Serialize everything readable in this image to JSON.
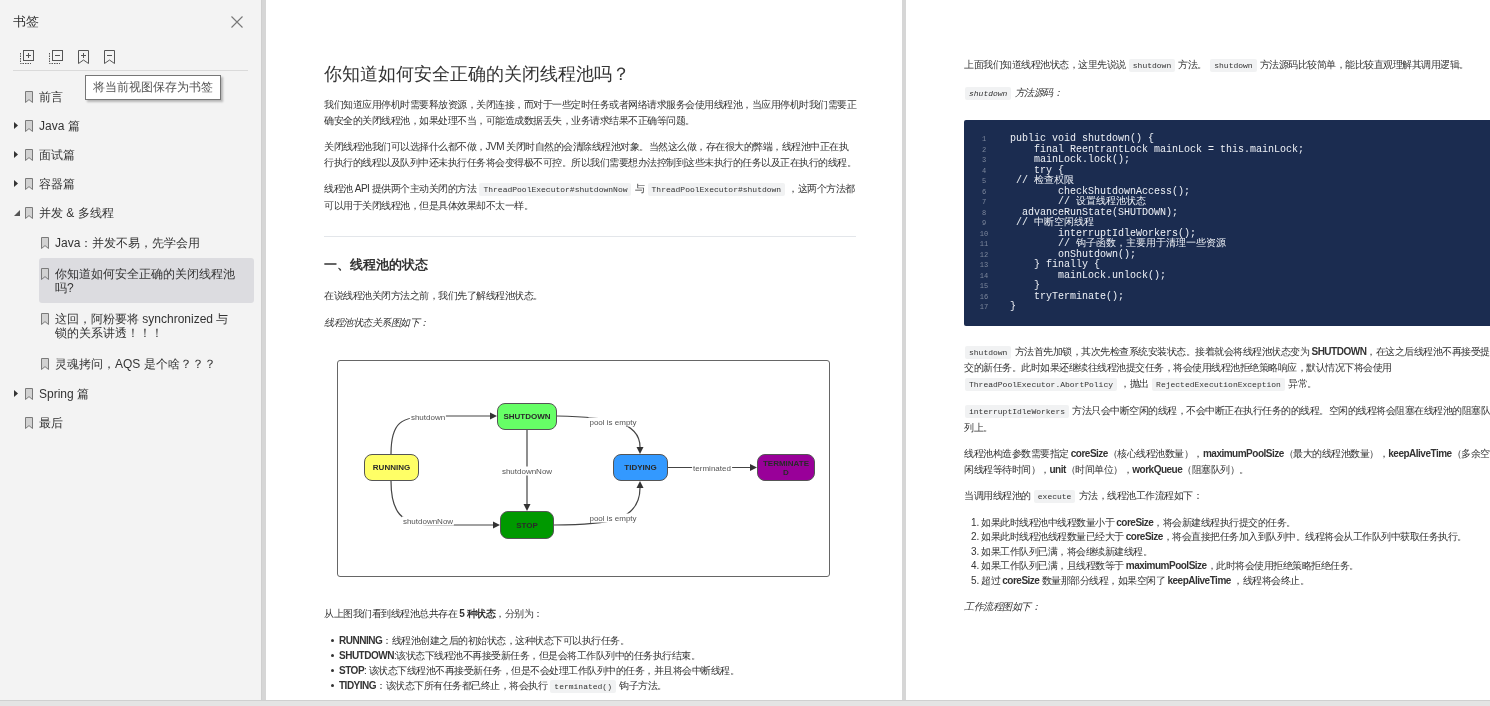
{
  "sidebar": {
    "title": "书签",
    "tooltip": "将当前视图保存为书签",
    "items": [
      {
        "label": "前言",
        "kind": "leaf",
        "selected": false
      },
      {
        "label": "Java 篇",
        "kind": "group",
        "expanded": false,
        "selected": false
      },
      {
        "label": "面试篇",
        "kind": "group",
        "expanded": false,
        "selected": false
      },
      {
        "label": "容器篇",
        "kind": "group",
        "expanded": false,
        "selected": false
      },
      {
        "label": "并发 & 多线程",
        "kind": "group",
        "expanded": true,
        "selected": false,
        "children": [
          {
            "label": "Java：并发不易，先学会用",
            "kind": "leaf",
            "selected": false
          },
          {
            "label": "你知道如何安全正确的关闭线程池吗?",
            "kind": "leaf",
            "selected": true
          },
          {
            "label": "这回，阿粉要将 synchronized 与锁的关系讲透！！！",
            "kind": "leaf",
            "selected": false
          },
          {
            "label": "灵魂拷问，AQS 是个啥？？？",
            "kind": "leaf",
            "selected": false
          }
        ]
      },
      {
        "label": "Spring 篇",
        "kind": "group",
        "expanded": false,
        "selected": false
      },
      {
        "label": "最后",
        "kind": "leaf",
        "selected": false
      }
    ]
  },
  "pages": [
    {
      "blocks": [
        {
          "kind": "title",
          "text": "你知道如何安全正确的关闭线程池吗？"
        },
        {
          "kind": "paragraph",
          "parts": [
            {
              "kind": "text",
              "text": "我们知道应用停机时需要释放资源，关闭连接，而对于一些定时任务或者网络请求服务会使用线程池，当应用停机时我们需要正确安全的关闭线程池，如果处理不当，可能造成数据丢失，业务请求结果不正确等问题。"
            }
          ]
        },
        {
          "kind": "paragraph",
          "parts": [
            {
              "kind": "text",
              "text": "关闭线程池我们可以选择什么都不做，JVM 关闭时自然的会清除线程池对象。当然这么做，存在很大的弊端，线程池中正在执行执行的线程以及队列中还未执行任务将会变得极不可控。所以我们需要想办法控制到这些未执行的任务以及正在执行的线程。"
            }
          ]
        },
        {
          "kind": "paragraph",
          "parts": [
            {
              "kind": "text",
              "text": "线程池 API 提供两个主动关闭的方法 "
            },
            {
              "kind": "code",
              "text": "ThreadPoolExecutor#shutdownNow"
            },
            {
              "kind": "text",
              "text": " 与 "
            },
            {
              "kind": "code",
              "text": "ThreadPoolExecutor#shutdown"
            },
            {
              "kind": "text",
              "text": " ，这两个方法都可以用于关闭线程池，但是具体效果却不太一样。"
            }
          ]
        },
        {
          "kind": "rule"
        },
        {
          "kind": "heading",
          "text": "一、线程池的状态"
        },
        {
          "kind": "paragraph",
          "parts": [
            {
              "kind": "text",
              "text": "在说线程池关闭方法之前，我们先了解线程池状态。"
            }
          ]
        },
        {
          "kind": "caption",
          "parts": [
            {
              "kind": "text",
              "text": "线程池状态关系图如下："
            }
          ]
        },
        {
          "kind": "diagram",
          "nodes": [
            {
              "label": "RUNNING",
              "color": "#ffff66"
            },
            {
              "label": "SHUTDOWN",
              "color": "#66ff66"
            },
            {
              "label": "STOP",
              "color": "#009900"
            },
            {
              "label": "TIDYING",
              "color": "#3399ff"
            },
            {
              "label": "TERMINATED",
              "color": "#990099"
            }
          ],
          "edges": [
            {
              "label": "shutdown"
            },
            {
              "label": "shutdownNow"
            },
            {
              "label": "shutdownNow"
            },
            {
              "label": "pool is empty"
            },
            {
              "label": "pool is empty"
            },
            {
              "label": "terminated"
            }
          ]
        },
        {
          "kind": "paragraph",
          "parts": [
            {
              "kind": "text",
              "text": "从上图我们看到线程池总共存在 **5 种状态**，分别为："
            }
          ]
        },
        {
          "kind": "bullets",
          "items": [
            {
              "parts": [
                {
                  "kind": "text",
                  "text": "**RUNNING**：线程池创建之后的初始状态，这种状态下可以执行任务。"
                }
              ]
            },
            {
              "parts": [
                {
                  "kind": "text",
                  "text": "**SHUTDOWN**:该状态下线程池不再接受新任务，但是会将工作队列中的任务执行结束。"
                }
              ]
            },
            {
              "parts": [
                {
                  "kind": "text",
                  "text": "**STOP**: 该状态下线程池不再接受新任务，但是不会处理工作队列中的任务，并且将会中断线程。"
                }
              ]
            },
            {
              "parts": [
                {
                  "kind": "text",
                  "text": "**TIDYING**：该状态下所有任务都已终止，将会执行 "
                },
                {
                  "kind": "code",
                  "text": "terminated()"
                },
                {
                  "kind": "text",
                  "text": " 钩子方法。"
                }
              ]
            }
          ]
        }
      ]
    },
    {
      "blocks": [
        {
          "kind": "paragraph",
          "parts": [
            {
              "kind": "text",
              "text": "上面我们知道线程池状态，这里先说说 "
            },
            {
              "kind": "code",
              "text": "shutdown"
            },
            {
              "kind": "text",
              "text": " 方法。 "
            },
            {
              "kind": "code",
              "text": "shutdown"
            },
            {
              "kind": "text",
              "text": " 方法源码比较简单，能比较直观理解其调用逻辑。"
            }
          ]
        },
        {
          "kind": "caption",
          "parts": [
            {
              "kind": "code",
              "text": "shutdown"
            },
            {
              "kind": "text",
              "text": " 方法源码："
            }
          ]
        },
        {
          "kind": "code",
          "lines": [
            {
              "number": "1",
              "text": "public void shutdown() {"
            },
            {
              "number": "2",
              "text": "    final ReentrantLock mainLock = this.mainLock;"
            },
            {
              "number": "3",
              "text": "    mainLock.lock();"
            },
            {
              "number": "4",
              "text": "    try {"
            },
            {
              "number": "5",
              "text": " // 检查权限"
            },
            {
              "number": "6",
              "text": "        checkShutdownAccess();"
            },
            {
              "number": "7",
              "text": "        // 设置线程池状态"
            },
            {
              "number": "8",
              "text": "  advanceRunState(SHUTDOWN);"
            },
            {
              "number": "9",
              "text": " // 中断空闲线程"
            },
            {
              "number": "10",
              "text": "        interruptIdleWorkers();"
            },
            {
              "number": "11",
              "text": "        // 钩子函数，主要用于清理一些资源"
            },
            {
              "number": "12",
              "text": "        onShutdown();"
            },
            {
              "number": "13",
              "text": "    } finally {"
            },
            {
              "number": "14",
              "text": "        mainLock.unlock();"
            },
            {
              "number": "15",
              "text": "    }"
            },
            {
              "number": "16",
              "text": "    tryTerminate();"
            },
            {
              "number": "17",
              "text": "}"
            }
          ]
        },
        {
          "kind": "paragraph",
          "parts": [
            {
              "kind": "code",
              "text": "shutdown"
            },
            {
              "kind": "text",
              "text": " 方法首先加锁，其次先检查系统安装状态。接着就会将线程池状态变为 **SHUTDOWN**，在这之后线程池不再接受提交的新任务。此时如果还继续往线程池提交任务，将会使用线程池拒绝策略响应，默认情况下将会使用 "
            },
            {
              "kind": "code",
              "text": "ThreadPoolExecutor.AbortPolicy"
            },
            {
              "kind": "text",
              "text": " ，抛出 "
            },
            {
              "kind": "code",
              "text": "RejectedExecutionException"
            },
            {
              "kind": "text",
              "text": " 异常。"
            }
          ]
        },
        {
          "kind": "paragraph",
          "parts": [
            {
              "kind": "code",
              "text": "interruptIdleWorkers"
            },
            {
              "kind": "text",
              "text": " 方法只会中断空闲的线程，不会中断正在执行任务的的线程。空闲的线程将会阻塞在线程池的阻塞队列上。"
            }
          ]
        },
        {
          "kind": "paragraph",
          "parts": [
            {
              "kind": "text",
              "text": "线程池构造参数需要指定 **coreSize**（核心线程池数量），**maximumPoolSize**（最大的线程池数量），**keepAliveTime**（多余空闲线程等待时间），**unit**（时间单位），**workQueue**（阻塞队列）。"
            }
          ]
        },
        {
          "kind": "paragraph",
          "parts": [
            {
              "kind": "text",
              "text": "当调用线程池的 "
            },
            {
              "kind": "code",
              "text": "execute"
            },
            {
              "kind": "text",
              "text": " 方法，线程池工作流程如下："
            }
          ]
        },
        {
          "kind": "numbered",
          "items": [
            {
              "marker": "1.",
              "parts": [
                {
                  "kind": "text",
                  "text": "如果此时线程池中线程数量小于 **coreSize**，将会新建线程执行提交的任务。"
                }
              ]
            },
            {
              "marker": "2.",
              "parts": [
                {
                  "kind": "text",
                  "text": "如果此时线程池线程数量已经大于 **coreSize**，将会直接把任务加入到队列中。线程将会从工作队列中获取任务执行。"
                }
              ]
            },
            {
              "marker": "3.",
              "parts": [
                {
                  "kind": "text",
                  "text": "如果工作队列已满，将会继续新建线程。"
                }
              ]
            },
            {
              "marker": "4.",
              "parts": [
                {
                  "kind": "text",
                  "text": "如果工作队列已满，且线程数等于 **maximumPoolSize**，此时将会使用拒绝策略拒绝任务。"
                }
              ]
            },
            {
              "marker": "5.",
              "parts": [
                {
                  "kind": "text",
                  "text": "超过 **coreSize** 数量那部分线程，如果空闲了 **keepAliveTime** ，线程将会终止。"
                }
              ]
            }
          ]
        },
        {
          "kind": "caption",
          "parts": [
            {
              "kind": "text",
              "text": "工作流程图如下："
            }
          ]
        }
      ]
    }
  ]
}
